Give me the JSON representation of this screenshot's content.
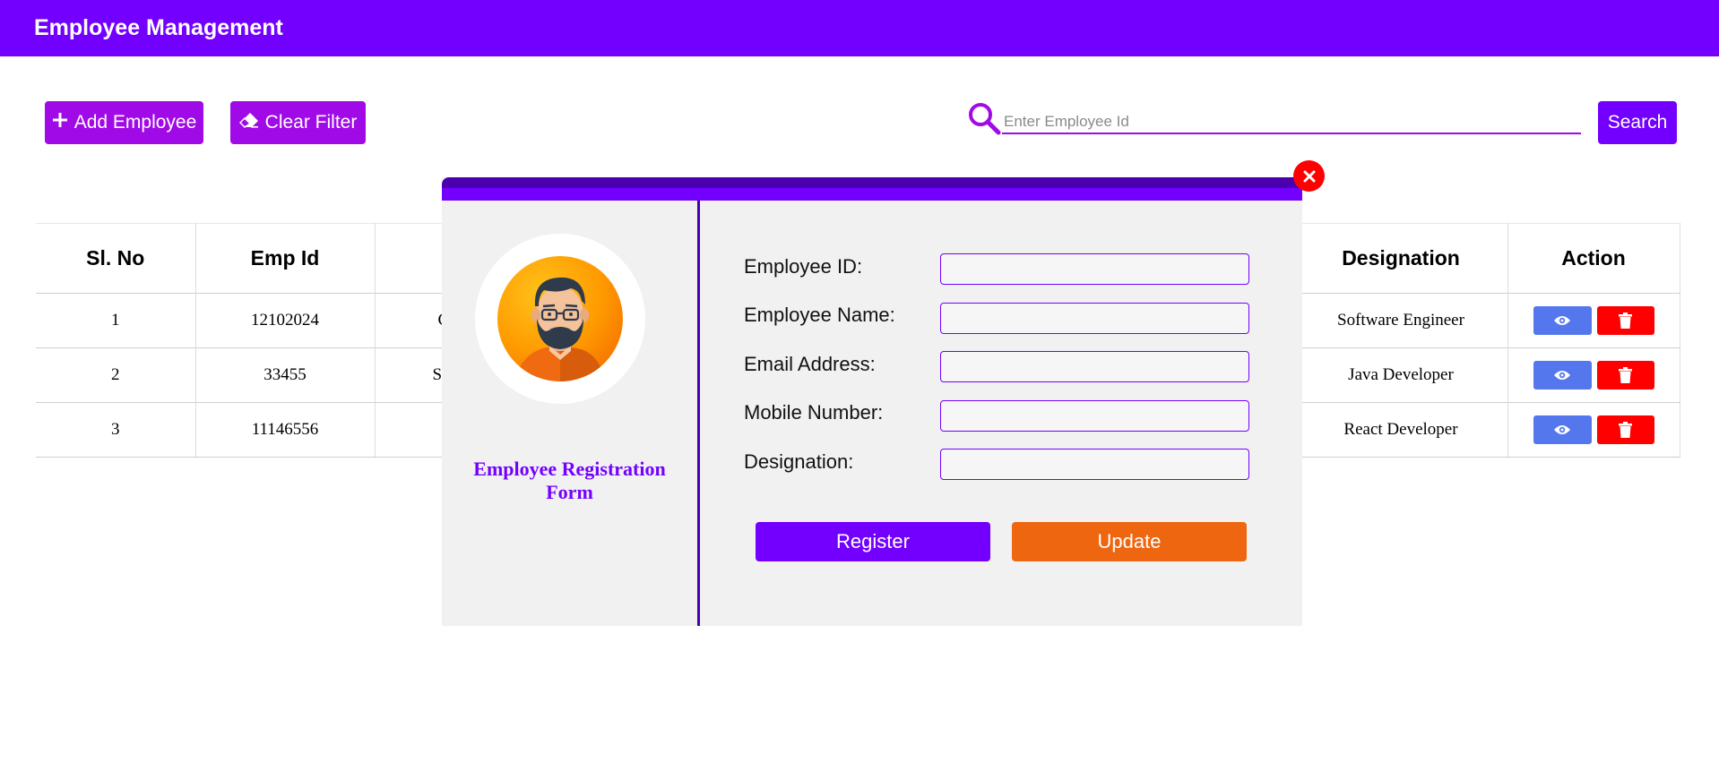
{
  "header": {
    "title": "Employee Management"
  },
  "toolbar": {
    "add_label": "Add Employee",
    "clear_label": "Clear Filter",
    "search_placeholder": "Enter Employee Id",
    "search_label": "Search"
  },
  "table": {
    "headers": [
      "Sl. No",
      "Emp Id",
      "Designation",
      "Action"
    ],
    "rows": [
      {
        "sl": "1",
        "emp_id": "12102024",
        "name_partial": "C",
        "designation": "Software Engineer"
      },
      {
        "sl": "2",
        "emp_id": "33455",
        "name_partial": "S",
        "designation": "Java Developer"
      },
      {
        "sl": "3",
        "emp_id": "11146556",
        "name_partial": "",
        "designation": "React Developer"
      }
    ]
  },
  "modal": {
    "caption": "Employee Registration Form",
    "fields": {
      "employee_id": "Employee ID:",
      "employee_name": "Employee Name:",
      "email": "Email Address:",
      "mobile": "Mobile Number:",
      "designation": "Designation:"
    },
    "register_label": "Register",
    "update_label": "Update"
  },
  "colors": {
    "primary": "#7300ff",
    "accent": "#a00ae6",
    "view": "#5577ee",
    "delete": "#ff0000",
    "update": "#ee6610"
  },
  "icons": [
    "plus-icon",
    "eraser-icon",
    "search-icon",
    "eye-icon",
    "trash-icon",
    "close-icon",
    "avatar"
  ]
}
